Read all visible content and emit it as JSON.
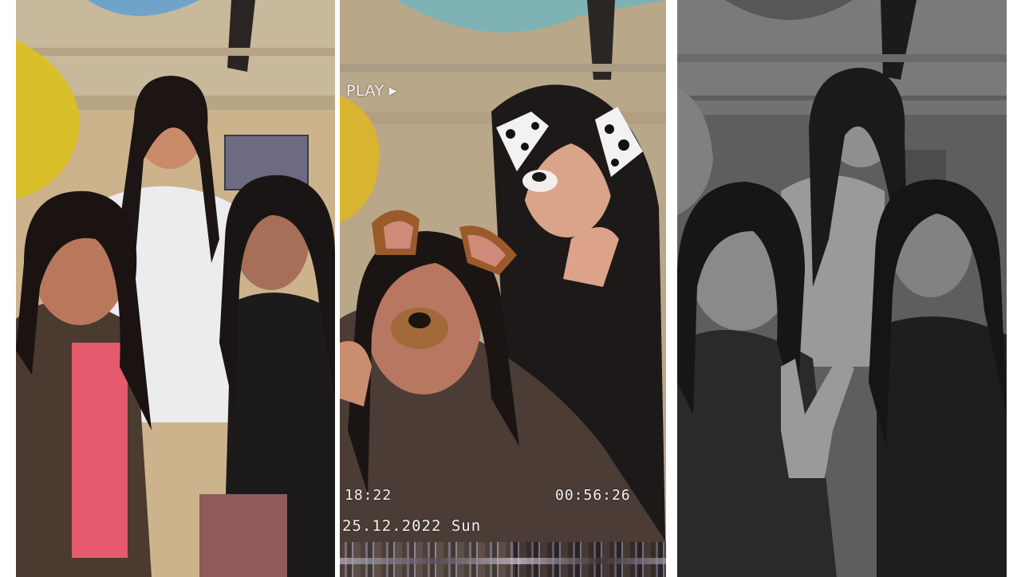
{
  "panels": [
    {
      "name": "color-photo",
      "filter": "none"
    },
    {
      "name": "vhs-snapchat-photo",
      "filter": "vhs"
    },
    {
      "name": "black-and-white-photo",
      "filter": "grayscale"
    }
  ],
  "overlay": {
    "play_label": "PLAY",
    "play_icon": "▶",
    "time": "18:22",
    "counter": "00:56:26",
    "date": "25.12.2022 Sun"
  },
  "colors": {
    "wall": "#d8b98a",
    "ceiling": "#c9b79a",
    "curtain": "#d9c02a",
    "hoodie_pink": "#e65a6e",
    "jacket_brown": "#4a3a30",
    "white_hoodie": "#ecebee",
    "dog_ear": "#9a5a2a"
  }
}
